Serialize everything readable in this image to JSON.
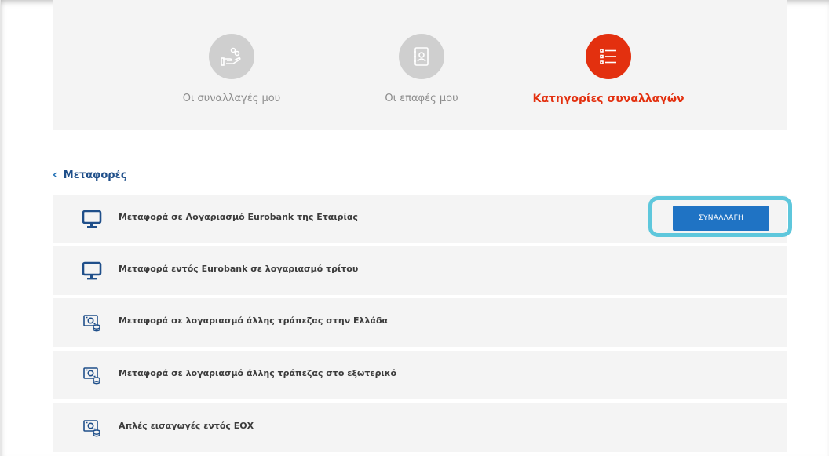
{
  "tabs": [
    {
      "label": "Οι συναλλαγές μου",
      "icon": "hand-coins-icon",
      "active": false
    },
    {
      "label": "Οι επαφές μου",
      "icon": "contacts-book-icon",
      "active": false
    },
    {
      "label": "Κατηγορίες συναλλαγών",
      "icon": "list-icon",
      "active": true
    }
  ],
  "breadcrumb": {
    "chevron": "‹",
    "label": "Μεταφορές"
  },
  "rows": [
    {
      "title": "Μεταφορά σε Λογαριασμό Eurobank της Εταιρίας",
      "icon": "monitor-icon"
    },
    {
      "title": "Μεταφορά εντός Eurobank σε λογαριασμό τρίτου",
      "icon": "monitor-icon"
    },
    {
      "title": "Μεταφορά σε λογαριασμό άλλης τράπεζας στην Ελλάδα",
      "icon": "money-transfer-icon"
    },
    {
      "title": "Μεταφορά σε λογαριασμό άλλης τράπεζας στο εξωτερικό",
      "icon": "money-transfer-icon"
    },
    {
      "title": "Απλές εισαγωγές εντός ΕΟΧ",
      "icon": "money-transfer-icon"
    }
  ],
  "action_button": {
    "label": "ΣΥΝΑΛΛΑΓΗ"
  },
  "colors": {
    "accent": "#e3300f",
    "primary": "#1f73c4",
    "highlight": "#5ec7dc"
  }
}
